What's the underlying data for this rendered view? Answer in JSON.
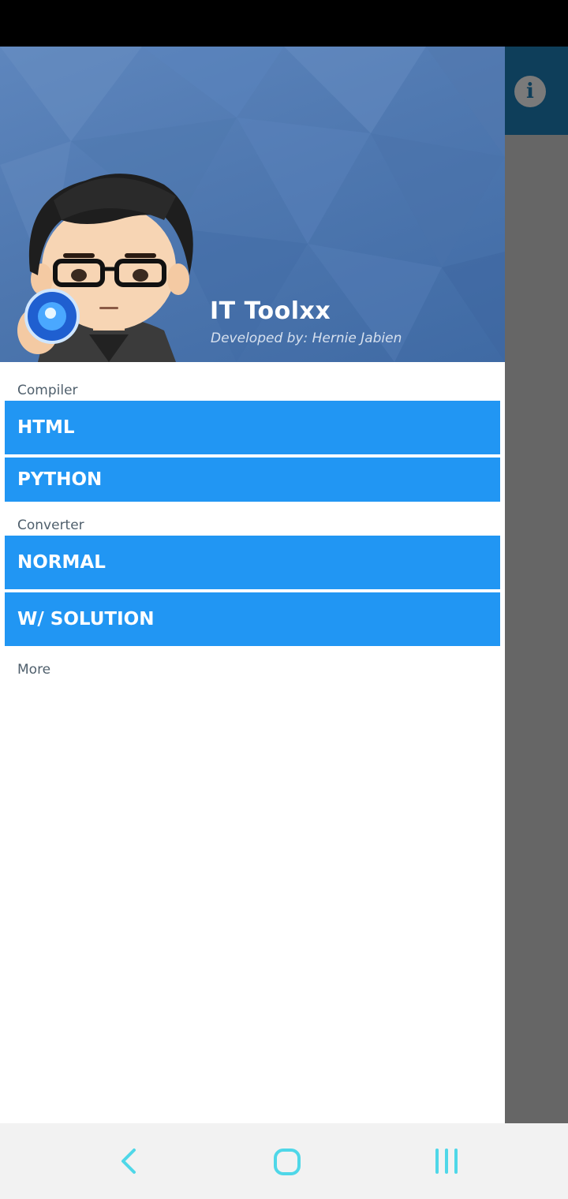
{
  "drawer": {
    "header": {
      "app_name": "IT Toolxx",
      "developer_credit": "Developed by: Hernie Jabien"
    },
    "sections": [
      {
        "label": "Compiler",
        "items": [
          "HTML",
          "PYTHON"
        ]
      },
      {
        "label": "Converter",
        "items": [
          "NORMAL",
          "W/ SOLUTION"
        ]
      },
      {
        "label": "More",
        "items": []
      }
    ]
  },
  "background_app": {
    "toolbar_icon": "info-icon",
    "info_glyph": "i"
  },
  "navigation_bar": {
    "icons": [
      "back-icon",
      "home-icon",
      "recent-apps-icon"
    ]
  },
  "colors": {
    "menu_button": "#2196f3",
    "header": "#4f78b0",
    "toolbar": "#0e3e5a",
    "scrim": "#666666"
  }
}
